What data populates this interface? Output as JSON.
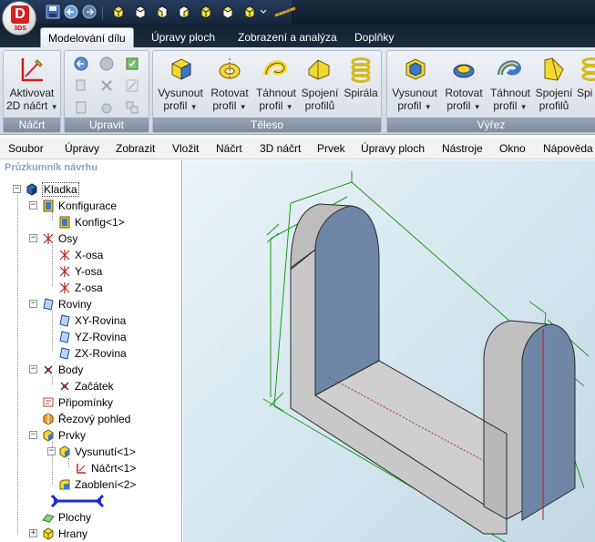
{
  "app": {
    "logo_letter": "D",
    "logo_sub": "3DS"
  },
  "ribbon_tabs": [
    {
      "label": "Modelování dílu",
      "active": true
    },
    {
      "label": "Úpravy ploch",
      "active": false
    },
    {
      "label": "Zobrazení a analýza",
      "active": false
    },
    {
      "label": "Doplňky",
      "active": false
    }
  ],
  "ribbon": {
    "groups": {
      "sketch": "Náčrt",
      "edit": "Upravit",
      "body": "Těleso",
      "cut": "Výřez"
    },
    "sketch_button": {
      "line1": "Aktivovat",
      "line2": "2D náčrt"
    },
    "body_buttons": [
      {
        "line1": "Vysunout",
        "line2": "profil",
        "icon": "extrude-icon"
      },
      {
        "line1": "Rotovat",
        "line2": "profil",
        "icon": "revolve-icon"
      },
      {
        "line1": "Táhnout",
        "line2": "profil",
        "icon": "sweep-icon"
      },
      {
        "line1": "Spojení",
        "line2": "profilů",
        "icon": "loft-icon"
      },
      {
        "line1": "Spirála",
        "line2": "",
        "icon": "helix-icon"
      }
    ],
    "cut_buttons": [
      {
        "line1": "Vysunout",
        "line2": "profil",
        "icon": "extrude-cut-icon"
      },
      {
        "line1": "Rotovat",
        "line2": "profil",
        "icon": "revolve-cut-icon"
      },
      {
        "line1": "Táhnout",
        "line2": "profil",
        "icon": "sweep-cut-icon"
      },
      {
        "line1": "Spojení",
        "line2": "profilů",
        "icon": "loft-cut-icon"
      },
      {
        "line1": "Spi",
        "line2": "",
        "icon": "helix-cut-icon"
      }
    ]
  },
  "menu": [
    "Soubor",
    "Úpravy",
    "Zobrazit",
    "Vložit",
    "Náčrt",
    "3D náčrt",
    "Prvek",
    "Úpravy ploch",
    "Nástroje",
    "Okno",
    "Nápověda"
  ],
  "explorer": {
    "title": "Průzkumník návrhu",
    "root": "Kladka",
    "nodes": {
      "configurations": "Konfigurace",
      "config1": "Konfig<1>",
      "axes": "Osy",
      "x_axis": "X-osa",
      "y_axis": "Y-osa",
      "z_axis": "Z-osa",
      "planes": "Roviny",
      "xy_plane": "XY-Rovina",
      "yz_plane": "YZ-Rovina",
      "zx_plane": "ZX-Rovina",
      "bodies": "Body",
      "origin": "Začátek",
      "notes": "Připomínky",
      "section_view": "Řezový pohled",
      "features": "Prvky",
      "extrude1": "Vysunutí<1>",
      "sketch1": "Náčrt<1>",
      "fillet2": "Zaoblení<2>",
      "faces": "Plochy",
      "edges": "Hrany"
    }
  },
  "colors": {
    "accent": "#1f3a5c",
    "model_face": "#6f87a6",
    "model_side": "#c8c8c8",
    "wire": "#1a9a1a"
  }
}
